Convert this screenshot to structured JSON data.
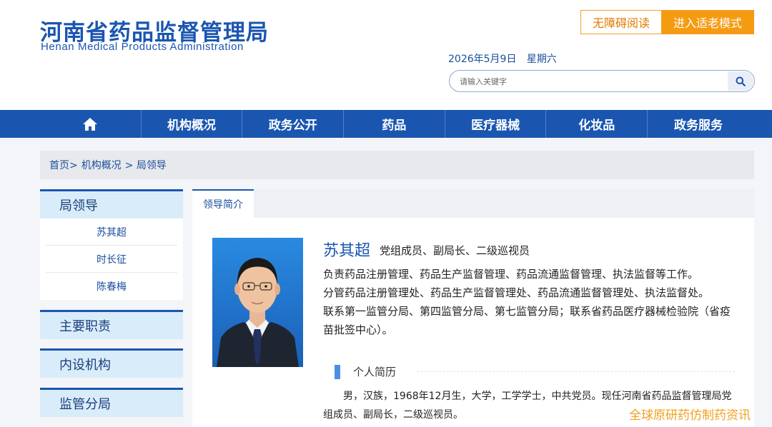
{
  "header": {
    "logo_cn": "河南省药品监督管理局",
    "logo_en": "Henan Medical Products Administration",
    "btn_accessible": "无障碍阅读",
    "btn_elder": "进入适老模式",
    "date": "2026年5月9日",
    "weekday": "星期六",
    "search_placeholder": "请输入关键字",
    "search_icon": "search-icon",
    "accent_color": "#1a56b0",
    "orange_color": "#f59b12"
  },
  "nav": {
    "home_icon": "home-icon",
    "items": [
      "机构概况",
      "政务公开",
      "药品",
      "医疗器械",
      "化妆品",
      "政务服务"
    ]
  },
  "breadcrumb": {
    "home": "首页>",
    "level1": "机构概况",
    "level2": "> 局领导"
  },
  "sidebar": {
    "section_leaders": "局领导",
    "leaders": [
      "苏其超",
      "时长征",
      "陈春梅"
    ],
    "section_duties": "主要职责",
    "section_units": "内设机构",
    "section_branches": "监管分局"
  },
  "main": {
    "tab_label": "领导简介",
    "name": "苏其超",
    "title": "党组成员、副局长、二级巡视员",
    "duty_lines": [
      "负责药品注册管理、药品生产监督管理、药品流通监督管理、执法监督等工作。",
      "分管药品注册管理处、药品生产监督管理处、药品流通监督管理处、执法监督处。",
      "联系第一监管分局、第四监管分局、第七监管分局；联系省药品医疗器械检验院（省疫苗批签中心）。"
    ],
    "resume_heading": "个人简历",
    "bio": "男，汉族，1968年12月生，大学，工学学士，中共党员。现任河南省药品监督管理局党组成员、副局长，二级巡视员。"
  },
  "watermark": "全球原研药仿制药资讯"
}
